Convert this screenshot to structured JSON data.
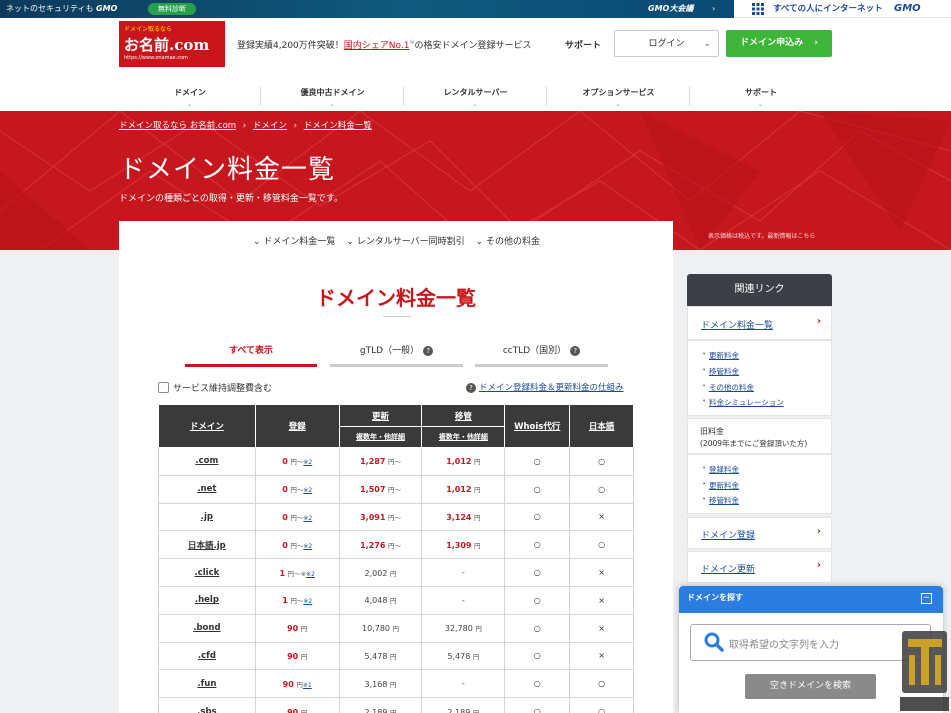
{
  "topbar": {
    "left_text": "ネットのセキュリティも",
    "left_brand": "GMO",
    "diagnosis_badge": "無料診断",
    "center_brand": "GMO大会議",
    "slogan": "すべての人にインターネット",
    "right_brand": "GMO"
  },
  "header": {
    "logo": {
      "line1": "ドメイン取るなら",
      "line2": "お名前.com",
      "line3": "https://www.onamae.com"
    },
    "tagline_pre": "登録実績4,200万件突破！",
    "tagline_link": "国内シェアNo.1",
    "tagline_sup": "※",
    "tagline_post": "の格安ドメイン登録サービス",
    "support": "サポート",
    "login": "ログイン",
    "apply": "ドメイン申込み"
  },
  "nav": [
    "ドメイン",
    "優良中古ドメイン",
    "レンタルサーバー",
    "オプションサービス",
    "サポート"
  ],
  "hero": {
    "breadcrumb": [
      "ドメイン取るなら お名前.com",
      "ドメイン",
      "ドメイン料金一覧"
    ],
    "title": "ドメイン料金一覧",
    "description": "ドメインの種類ごとの取得・更新・移管料金一覧です。",
    "note": "表示価格は税込です。最新情報はこちら"
  },
  "subnav": [
    "ドメイン料金一覧",
    "レンタルサーバー同時割引",
    "その他の料金"
  ],
  "main": {
    "title": "ドメイン料金一覧",
    "tabs": [
      {
        "label": "すべて表示",
        "help": false
      },
      {
        "label": "gTLD（一般）",
        "help": true
      },
      {
        "label": "ccTLD（国別）",
        "help": true
      }
    ],
    "checkbox_label": "サービス維持調整費含む",
    "mechanism_link": "ドメイン登録料金＆更新料金の仕組み"
  },
  "table": {
    "headers": {
      "domain": "ドメイン",
      "register": "登録",
      "renew": "更新",
      "transfer": "移管",
      "whois": "Whois代行",
      "japanese": "日本語"
    },
    "subheaders": {
      "renew": "複数年・他詳細",
      "transfer": "複数年・他詳細"
    },
    "yen": "円",
    "rows": [
      {
        "domain": ".com",
        "reg": "0",
        "reg_suffix": "～",
        "reg_note": "※2",
        "renew": "1,287",
        "renew_red": true,
        "renew_suffix": "～",
        "transfer": "1,012",
        "transfer_red": true,
        "whois": "○",
        "jp": "○"
      },
      {
        "domain": ".net",
        "reg": "0",
        "reg_suffix": "～",
        "reg_note": "※2",
        "renew": "1,507",
        "renew_red": true,
        "renew_suffix": "～",
        "transfer": "1,012",
        "transfer_red": true,
        "whois": "○",
        "jp": "○"
      },
      {
        "domain": ".jp",
        "reg": "0",
        "reg_suffix": "～",
        "reg_note": "※2",
        "renew": "3,091",
        "renew_red": true,
        "renew_suffix": "～",
        "transfer": "3,124",
        "transfer_red": true,
        "whois": "○",
        "jp": "×"
      },
      {
        "domain": "日本語.jp",
        "reg": "0",
        "reg_suffix": "～",
        "reg_note": "※2",
        "renew": "1,276",
        "renew_red": true,
        "renew_suffix": "～",
        "transfer": "1,309",
        "transfer_red": true,
        "whois": "○",
        "jp": "○"
      },
      {
        "domain": ".click",
        "reg": "1",
        "reg_suffix": "～※",
        "reg_note": "※2",
        "renew": "2,002",
        "renew_red": false,
        "renew_suffix": "",
        "transfer": "-",
        "transfer_red": false,
        "whois": "○",
        "jp": "×"
      },
      {
        "domain": ".help",
        "reg": "1",
        "reg_suffix": "～",
        "reg_note": "※2",
        "renew": "4,048",
        "renew_red": false,
        "renew_suffix": "",
        "transfer": "-",
        "transfer_red": false,
        "whois": "○",
        "jp": "×"
      },
      {
        "domain": ".bond",
        "reg": "90",
        "reg_suffix": "",
        "reg_note": "",
        "renew": "10,780",
        "renew_red": false,
        "renew_suffix": "",
        "transfer": "32,780",
        "transfer_red": false,
        "whois": "○",
        "jp": "×"
      },
      {
        "domain": ".cfd",
        "reg": "90",
        "reg_suffix": "",
        "reg_note": "",
        "renew": "5,478",
        "renew_red": false,
        "renew_suffix": "",
        "transfer": "5,478",
        "transfer_red": false,
        "whois": "○",
        "jp": "×"
      },
      {
        "domain": ".fun",
        "reg": "90",
        "reg_suffix": "",
        "reg_note": "※1",
        "renew": "3,168",
        "renew_red": false,
        "renew_suffix": "",
        "transfer": "-",
        "transfer_red": false,
        "whois": "○",
        "jp": "○"
      },
      {
        "domain": ".sbs",
        "reg": "90",
        "reg_suffix": "",
        "reg_note": "",
        "renew": "2,189",
        "renew_red": false,
        "renew_suffix": "",
        "transfer": "2,189",
        "transfer_red": false,
        "whois": "○",
        "jp": "○"
      }
    ]
  },
  "sidebar": {
    "title": "関連リンク",
    "current_group": {
      "label": "ドメイン料金一覧",
      "items": [
        "更新料金",
        "移管料金",
        "その他の料金",
        "料金シミュレーション"
      ]
    },
    "old_group": {
      "label": "旧料金",
      "desc": "(2009年までにご登録頂いた方)",
      "items": [
        "登録料金",
        "更新料金",
        "移管料金"
      ]
    },
    "links": [
      "ドメイン登録",
      "ドメイン更新"
    ]
  },
  "search_widget": {
    "title": "ドメインを探す",
    "minimize": "−",
    "placeholder": "取得希望の文字列を入力",
    "button": "空きドメインを検索"
  },
  "colors": {
    "brand_red": "#c9161d",
    "accent_green": "#3cb539",
    "widget_blue": "#2b7de0",
    "dark_header": "#3a3a3a"
  }
}
